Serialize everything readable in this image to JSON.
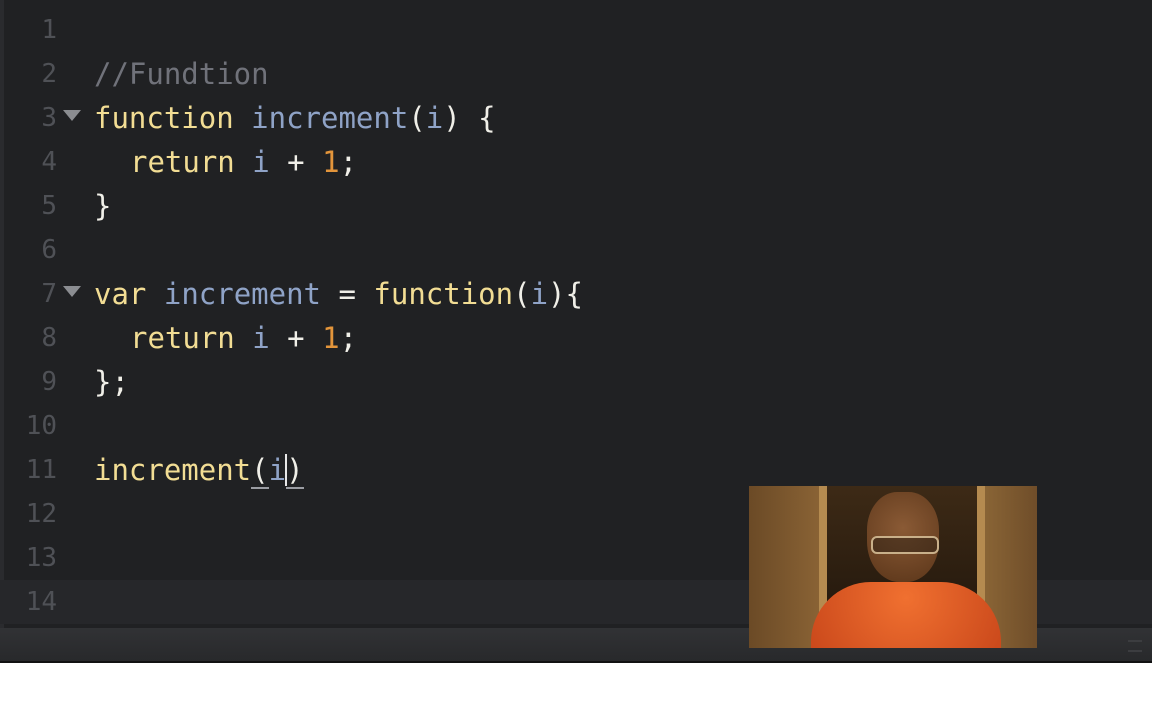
{
  "editor": {
    "lines": [
      {
        "n": "1"
      },
      {
        "n": "2",
        "comment": "//Fundtion"
      },
      {
        "n": "3",
        "fold": true,
        "kw": "function",
        "name": "increment",
        "p1": "(",
        "param": "i",
        "rest": ") {"
      },
      {
        "n": "4",
        "kw": "return",
        "var": "i",
        "op": "+",
        "num": "1",
        "end": ";"
      },
      {
        "n": "5",
        "text": "}"
      },
      {
        "n": "6"
      },
      {
        "n": "7",
        "fold": true,
        "kw": "var",
        "name": "increment",
        "op": "=",
        "fnkw": "function",
        "p1": "(",
        "param": "i",
        "rest": "){"
      },
      {
        "n": "8",
        "kw": "return",
        "var": "i",
        "op": "+",
        "num": "1",
        "end": ";"
      },
      {
        "n": "9",
        "text": "};"
      },
      {
        "n": "10"
      },
      {
        "n": "11",
        "call": "increment",
        "p1": "(",
        "param": "i",
        "p2": ")"
      },
      {
        "n": "12"
      },
      {
        "n": "13"
      },
      {
        "n": "14",
        "current": true
      }
    ]
  },
  "webcam": {
    "label": "presenter-video"
  }
}
